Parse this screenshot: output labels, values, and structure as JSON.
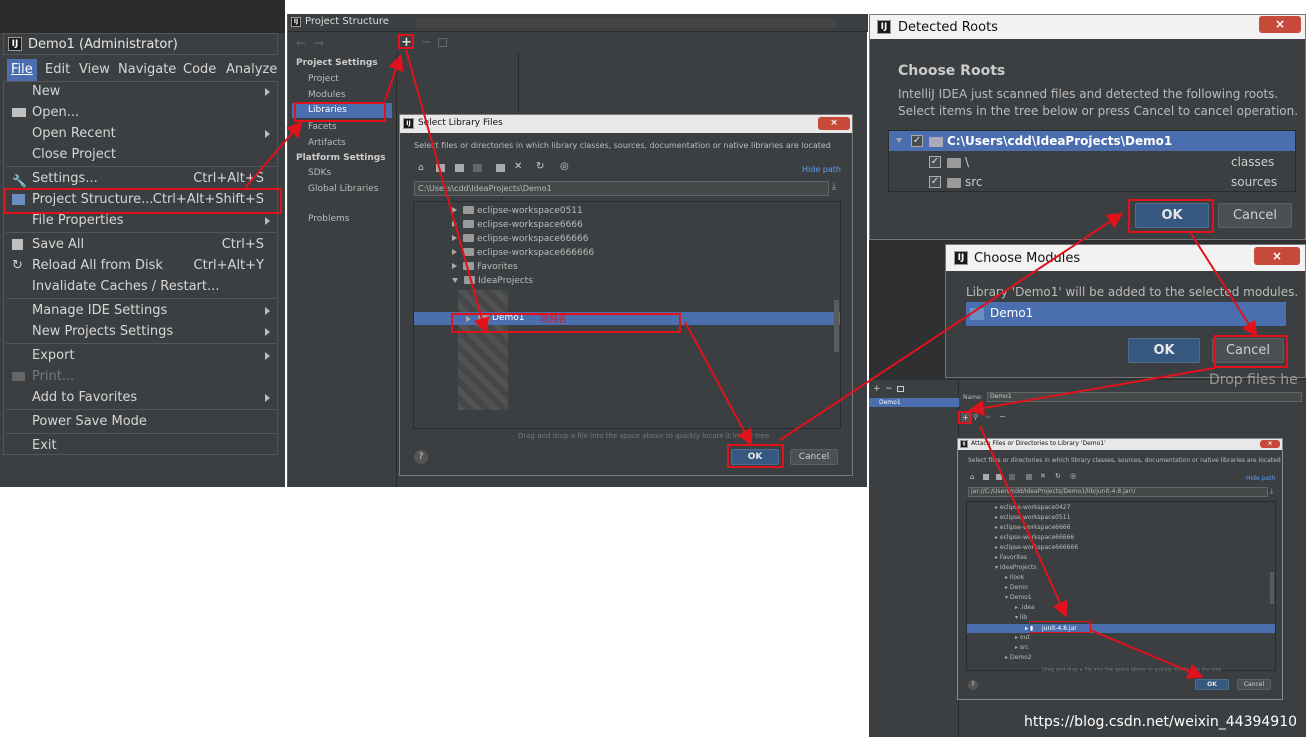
{
  "file_menu": {
    "window_title": "Demo1 (Administrator)",
    "menubar": [
      "File",
      "Edit",
      "View",
      "Navigate",
      "Code",
      "Analyze"
    ],
    "items": [
      {
        "label": "New",
        "shortcut": "",
        "submenu": true
      },
      {
        "label": "Open...",
        "shortcut": "",
        "submenu": false
      },
      {
        "label": "Open Recent",
        "shortcut": "",
        "submenu": true
      },
      {
        "label": "Close Project",
        "shortcut": "",
        "submenu": false
      },
      {
        "label": "Settings...",
        "shortcut": "Ctrl+Alt+S",
        "submenu": false
      },
      {
        "label": "Project Structure...",
        "shortcut": "Ctrl+Alt+Shift+S",
        "submenu": false
      },
      {
        "label": "File Properties",
        "shortcut": "",
        "submenu": true
      },
      {
        "label": "Save All",
        "shortcut": "Ctrl+S",
        "submenu": false
      },
      {
        "label": "Reload All from Disk",
        "shortcut": "Ctrl+Alt+Y",
        "submenu": false
      },
      {
        "label": "Invalidate Caches / Restart...",
        "shortcut": "",
        "submenu": false
      },
      {
        "label": "Manage IDE Settings",
        "shortcut": "",
        "submenu": true
      },
      {
        "label": "New Projects Settings",
        "shortcut": "",
        "submenu": true
      },
      {
        "label": "Export",
        "shortcut": "",
        "submenu": true
      },
      {
        "label": "Print...",
        "shortcut": "",
        "submenu": false
      },
      {
        "label": "Add to Favorites",
        "shortcut": "",
        "submenu": true
      },
      {
        "label": "Power Save Mode",
        "shortcut": "",
        "submenu": false
      },
      {
        "label": "Exit",
        "shortcut": "",
        "submenu": false
      }
    ]
  },
  "project_structure": {
    "title": "Project Structure",
    "section_project": "Project Settings",
    "project_items": [
      "Project",
      "Modules",
      "Libraries",
      "Facets",
      "Artifacts"
    ],
    "section_platform": "Platform Settings",
    "platform_items": [
      "SDKs",
      "Global Libraries"
    ],
    "problems": "Problems"
  },
  "select_library": {
    "title": "Select Library Files",
    "description": "Select files or directories in which library classes, sources, documentation or native libraries are located",
    "hide_path": "Hide path",
    "path": "C:\\Users\\cdd\\IdeaProjects\\Demo1",
    "tree": [
      "eclipse-workspace0511",
      "eclipse-workspace6666",
      "eclipse-workspace66666",
      "eclipse-workspace666666",
      "Favorites",
      "IdeaProjects"
    ],
    "selected": "Demo1",
    "annotation": "项目名",
    "drag_hint": "Drag and drop a file into the space above to quickly locate it in the tree",
    "ok": "OK",
    "cancel": "Cancel",
    "help": "?"
  },
  "detected_roots": {
    "title": "Detected Roots",
    "heading": "Choose Roots",
    "line1": "IntelliJ IDEA just scanned files and detected the following roots.",
    "line2": "Select items in the tree below or press Cancel to cancel operation.",
    "root": "C:\\Users\\cdd\\IdeaProjects\\Demo1",
    "rows": [
      {
        "name": "\\",
        "type": "classes"
      },
      {
        "name": "src",
        "type": "sources"
      }
    ],
    "ok": "OK",
    "cancel": "Cancel"
  },
  "choose_modules": {
    "title": "Choose Modules",
    "message": "Library 'Demo1' will be added to the selected modules.",
    "module": "Demo1",
    "ok": "OK",
    "cancel": "Cancel"
  },
  "attach_dialog": {
    "bg_text": "Drop files he",
    "module_name": "Demo1",
    "name_label": "Name:",
    "name_value": "Demo1",
    "title": "Attach Files or Directories to Library 'Demo1'",
    "description": "Select files or directories in which library classes, sources, documentation or native libraries are located",
    "hide_path": "Hide path",
    "path": "jar://C:/Users/cdd/IdeaProjects/Demo1/lib/junit-4.8.jar!/",
    "tree": [
      "eclipse-workspace0427",
      "eclipse-workspace0511",
      "eclipse-workspace6666",
      "eclipse-workspace66666",
      "eclipse-workspace666666",
      "Favorites",
      "IdeaProjects",
      "Ilook",
      "Demo",
      "Demo1",
      ".idea",
      "lib",
      "junit-4.8.jar",
      "out",
      "src",
      "Demo2"
    ],
    "drag_hint": "Drag and drop a file into the space above to quickly locate it in the tree",
    "ok": "OK",
    "cancel": "Cancel",
    "help": "?"
  },
  "watermark": "https://blog.csdn.net/weixin_44394910",
  "colors": {
    "highlight": "#e0121b",
    "selection": "#4b6eaf",
    "panel": "#3c3f41"
  }
}
